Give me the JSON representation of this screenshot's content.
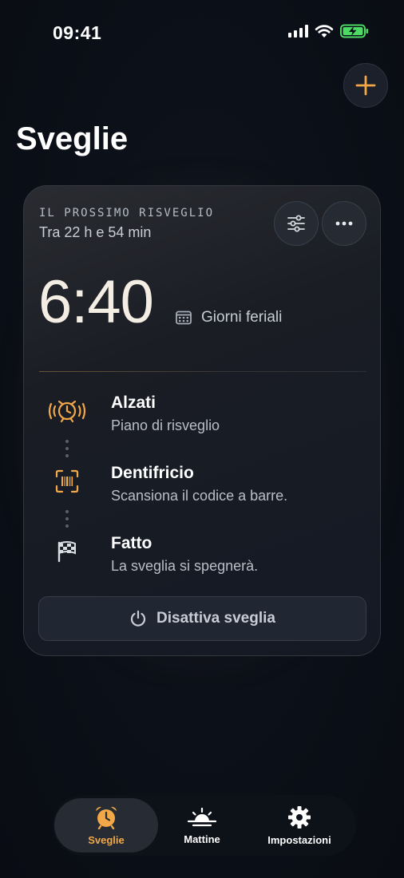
{
  "status_bar": {
    "time": "09:41"
  },
  "header": {
    "title": "Sveglie",
    "add_icon": "plus-icon"
  },
  "colors": {
    "accent": "#F2A848",
    "battery": "#4CD964",
    "background": "#0B0F17"
  },
  "next_alarm": {
    "label": "IL PROSSIMO RISVEGLIO",
    "countdown": "Tra 22 h e 54 min",
    "time": "6:40",
    "days": "Giorni feriali",
    "filter_icon": "sliders-icon",
    "more_icon": "ellipsis-icon"
  },
  "steps": [
    {
      "title": "Alzati",
      "description": "Piano di risveglio",
      "icon": "ringing-alarm-icon"
    },
    {
      "title": "Dentifricio",
      "description": "Scansiona il codice a barre.",
      "icon": "barcode-scan-icon"
    },
    {
      "title": "Fatto",
      "description": "La sveglia si spegnerà.",
      "icon": "checkered-flag-icon"
    }
  ],
  "disable_button": {
    "label": "Disattiva sveglia",
    "icon": "power-icon"
  },
  "tabs": [
    {
      "label": "Sveglie",
      "icon": "alarm-clock-icon",
      "active": true
    },
    {
      "label": "Mattine",
      "icon": "sunrise-icon",
      "active": false
    },
    {
      "label": "Impostazioni",
      "icon": "gear-icon",
      "active": false
    }
  ]
}
